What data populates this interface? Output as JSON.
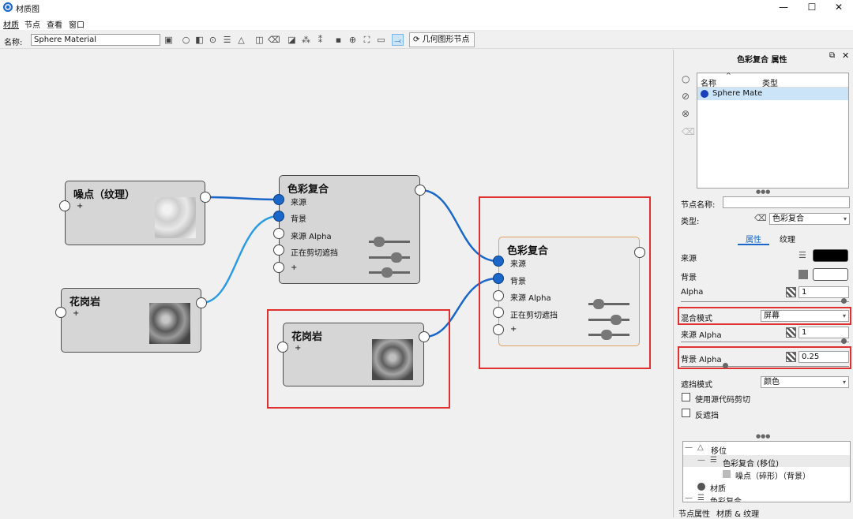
{
  "window": {
    "title": "材质图",
    "min": "—",
    "max": "☐",
    "close": "✕"
  },
  "menu": [
    "材质",
    "节点",
    "查看",
    "窗口"
  ],
  "toolbar": {
    "name_label": "名称:",
    "name_value": "Sphere Material",
    "geo_button": "几何图形节点"
  },
  "nodes": {
    "noise": {
      "title": "噪点（纹理）",
      "add": "+"
    },
    "granite1": {
      "title": "花岗岩",
      "add": "+"
    },
    "granite2": {
      "title": "花岗岩",
      "add": "+"
    },
    "comp1": {
      "title": "色彩复合",
      "rows": [
        "来源",
        "背景",
        "来源 Alpha",
        "正在剪切遮挡",
        "+"
      ]
    },
    "comp2": {
      "title": "色彩复合",
      "rows": [
        "来源",
        "背景",
        "来源 Alpha",
        "正在剪切遮挡",
        "+"
      ]
    }
  },
  "panel": {
    "title": "色彩复合 属性",
    "list_headers": {
      "name": "名称",
      "type": "类型"
    },
    "list_item": "Sphere Mate",
    "node_name_label": "节点名称:",
    "node_name_value": "",
    "type_label": "类型:",
    "type_value": "色彩复合",
    "tabs": [
      "属性",
      "纹理"
    ],
    "source_label": "来源",
    "bg_label": "背景",
    "alpha_label": "Alpha",
    "alpha_value": "1",
    "blend_label": "混合模式",
    "blend_value": "屏幕",
    "src_alpha_label": "来源 Alpha",
    "src_alpha_value": "1",
    "bg_alpha_label": "背景 Alpha",
    "bg_alpha_value": "0.25",
    "mask_mode_label": "遮挡模式",
    "mask_mode_value": "颜色",
    "cb1": "使用源代码剪切",
    "cb2": "反遮挡",
    "tree": [
      "移位",
      "色彩复合 (移位)",
      "噪点（碎形）（背景）",
      "材质",
      "色彩复合"
    ],
    "bottom_tabs": [
      "节点属性",
      "材质 & 纹理"
    ],
    "dots": "●●●"
  },
  "colors": {
    "accent": "#1a66c9",
    "highlight": "#e03030",
    "selected_border": "#e0a060"
  }
}
